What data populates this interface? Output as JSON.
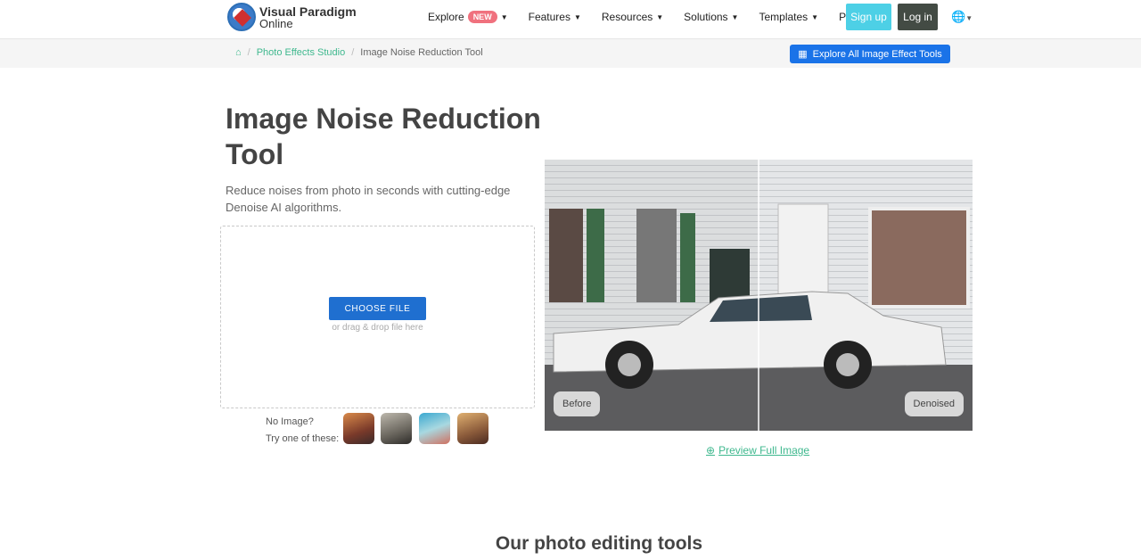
{
  "brand": {
    "line1": "Visual Paradigm",
    "line2": "Online"
  },
  "nav": {
    "items": [
      {
        "label": "Explore",
        "badge": "NEW"
      },
      {
        "label": "Features"
      },
      {
        "label": "Resources"
      },
      {
        "label": "Solutions"
      },
      {
        "label": "Templates"
      },
      {
        "label": "Pricing"
      }
    ],
    "signup": "Sign up",
    "login": "Log in"
  },
  "breadcrumb": {
    "items": [
      "Photo Effects Studio",
      "Image Noise Reduction Tool"
    ]
  },
  "explore_all": "Explore All Image Effect Tools",
  "hero": {
    "title": "Image Noise Reduction Tool",
    "subtitle": "Reduce noises from photo in seconds with cutting-edge Denoise AI algorithms."
  },
  "upload": {
    "button": "CHOOSE FILE",
    "hint": "or drag & drop file here"
  },
  "samples": {
    "line1": "No Image?",
    "line2": "Try one of these:"
  },
  "compare": {
    "before": "Before",
    "after": "Denoised"
  },
  "preview_link": "Preview Full Image",
  "section_title": "Our photo editing tools",
  "colors": {
    "accent": "#1a73e8",
    "green": "#3fb88e",
    "signup": "#4dd0e6"
  }
}
